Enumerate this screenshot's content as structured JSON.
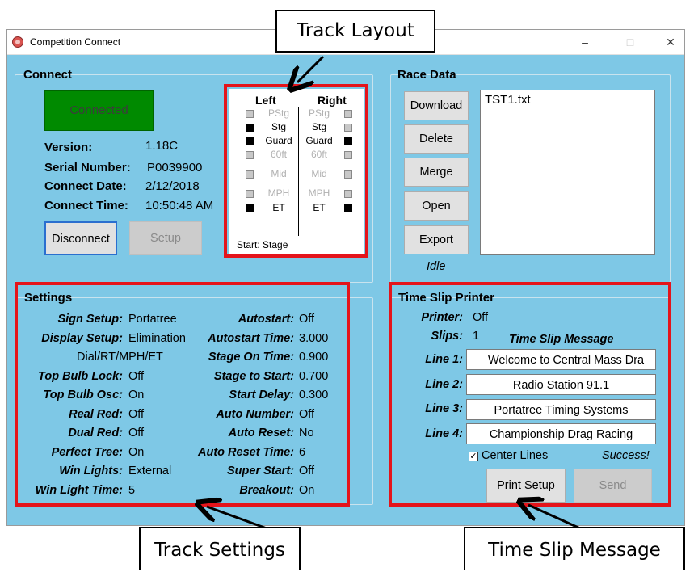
{
  "window": {
    "title": "Competition Connect"
  },
  "connect": {
    "group_title": "Connect",
    "status": "Connected",
    "status_color": "#008a00",
    "version_label": "Version:",
    "version": "1.18C",
    "serial_label": "Serial Number:",
    "serial": "P0039900",
    "date_label": "Connect Date:",
    "date": "2/12/2018",
    "time_label": "Connect Time:",
    "time": "10:50:48 AM",
    "disconnect_label": "Disconnect",
    "setup_label": "Setup"
  },
  "track_layout": {
    "left_header": "Left",
    "right_header": "Right",
    "rows": [
      {
        "label": "PStg",
        "left_on": false,
        "right_on": false
      },
      {
        "label": "Stg",
        "left_on": true,
        "right_on": false
      },
      {
        "label": "Guard",
        "left_on": true,
        "right_on": true
      },
      {
        "label": "60ft",
        "left_on": false,
        "right_on": false
      },
      {
        "label": "Mid",
        "left_on": false,
        "right_on": false
      },
      {
        "label": "MPH",
        "left_on": false,
        "right_on": false
      },
      {
        "label": "ET",
        "left_on": true,
        "right_on": true
      }
    ],
    "start_text": "Start: Stage"
  },
  "race_data": {
    "group_title": "Race Data",
    "buttons": [
      "Download",
      "Delete",
      "Merge",
      "Open",
      "Export"
    ],
    "files": [
      "TST1.txt"
    ],
    "status": "Idle"
  },
  "settings": {
    "group_title": "Settings",
    "left": [
      {
        "label": "Sign Setup:",
        "value": "Portatree"
      },
      {
        "label": "Display Setup:",
        "value": "Elimination"
      },
      {
        "label": "",
        "value": "Dial/RT/MPH/ET"
      },
      {
        "label": "Top Bulb Lock:",
        "value": "Off"
      },
      {
        "label": "Top Bulb Osc:",
        "value": "On"
      },
      {
        "label": "Real Red:",
        "value": "Off"
      },
      {
        "label": "Dual Red:",
        "value": "Off"
      },
      {
        "label": "Perfect Tree:",
        "value": "On"
      },
      {
        "label": "Win Lights:",
        "value": "External"
      },
      {
        "label": "Win Light Time:",
        "value": "5"
      }
    ],
    "right": [
      {
        "label": "Autostart:",
        "value": "Off"
      },
      {
        "label": "Autostart Time:",
        "value": "3.000"
      },
      {
        "label": "Stage On Time:",
        "value": "0.900"
      },
      {
        "label": "Stage to Start:",
        "value": "0.700"
      },
      {
        "label": "Start Delay:",
        "value": "0.300"
      },
      {
        "label": "Auto Number:",
        "value": "Off"
      },
      {
        "label": "Auto Reset:",
        "value": "No"
      },
      {
        "label": "Auto Reset Time:",
        "value": "6"
      },
      {
        "label": "Super Start:",
        "value": "Off"
      },
      {
        "label": "Breakout:",
        "value": "On"
      }
    ]
  },
  "printer": {
    "group_title": "Time Slip Printer",
    "printer_label": "Printer:",
    "printer_value": "Off",
    "slips_label": "Slips:",
    "slips_value": "1",
    "message_header": "Time Slip Message",
    "lines": [
      {
        "label": "Line 1:",
        "value": "Welcome to Central Mass Dra"
      },
      {
        "label": "Line 2:",
        "value": "Radio Station 91.1"
      },
      {
        "label": "Line 3:",
        "value": "Portatree Timing Systems"
      },
      {
        "label": "Line 4:",
        "value": "Championship Drag Racing"
      }
    ],
    "center_lines_label": "Center Lines",
    "center_lines_checked": true,
    "status": "Success!",
    "print_setup_label": "Print Setup",
    "send_label": "Send"
  },
  "annotations": {
    "track_layout": "Track Layout",
    "track_settings": "Track Settings",
    "time_slip_message": "Time Slip Message",
    "highlight_color": "#e4141b"
  }
}
